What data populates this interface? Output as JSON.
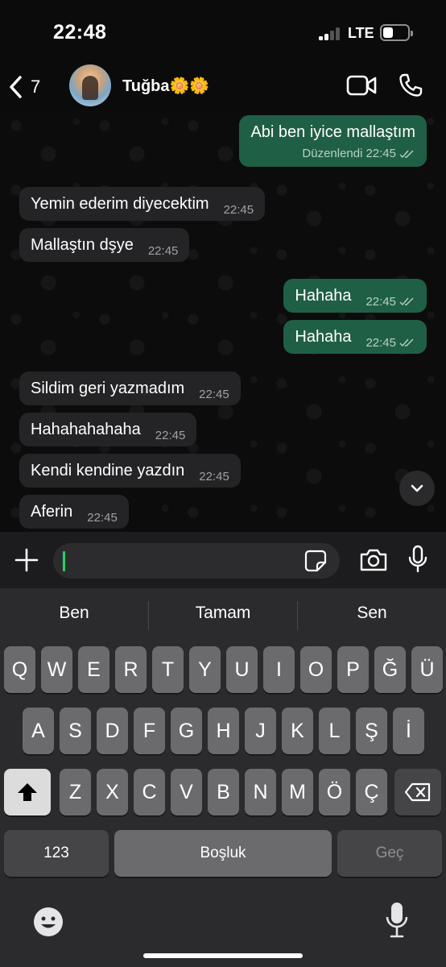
{
  "status": {
    "time": "22:48",
    "network": "LTE",
    "signal_bars": 2,
    "battery_level": 0.3
  },
  "header": {
    "back_count": "7",
    "contact_name": "Tuğba",
    "contact_emoji": "🌼🌼"
  },
  "messages": [
    {
      "dir": "out",
      "text": "Abi ben iyice mallaştım",
      "edited": "Düzenlendi",
      "time": "22:45"
    },
    {
      "dir": "in",
      "text": "Yemin ederim diyecektim",
      "time": "22:45"
    },
    {
      "dir": "in",
      "text": "Mallaştın dşye",
      "time": "22:45"
    },
    {
      "dir": "out",
      "text": "Hahaha",
      "time": "22:45"
    },
    {
      "dir": "out",
      "text": "Hahaha",
      "time": "22:45"
    },
    {
      "dir": "in",
      "text": "Sildim geri yazmadım",
      "time": "22:45"
    },
    {
      "dir": "in",
      "text": "Hahahahahaha",
      "time": "22:45"
    },
    {
      "dir": "in",
      "text": "Kendi kendine yazdın",
      "time": "22:45"
    },
    {
      "dir": "in",
      "text": "Aferin",
      "time": "22:45"
    }
  ],
  "composer": {
    "value": "",
    "placeholder": ""
  },
  "keyboard": {
    "suggestions": [
      "Ben",
      "Tamam",
      "Sen"
    ],
    "row1": [
      "Q",
      "W",
      "E",
      "R",
      "T",
      "Y",
      "U",
      "I",
      "O",
      "P",
      "Ğ",
      "Ü"
    ],
    "row2": [
      "A",
      "S",
      "D",
      "F",
      "G",
      "H",
      "J",
      "K",
      "L",
      "Ş",
      "İ"
    ],
    "row3": [
      "Z",
      "X",
      "C",
      "V",
      "B",
      "N",
      "M",
      "Ö",
      "Ç"
    ],
    "numbers_label": "123",
    "space_label": "Boşluk",
    "return_label": "Geç"
  },
  "colors": {
    "outgoing_bubble": "#1f5f45",
    "incoming_bubble": "#242426",
    "accent": "#25d366"
  },
  "icons": [
    "back-chevron-icon",
    "video-call-icon",
    "phone-icon",
    "plus-icon",
    "sticker-icon",
    "camera-icon",
    "microphone-icon",
    "chevron-down-icon",
    "shift-icon",
    "backspace-icon",
    "emoji-icon",
    "dictation-icon"
  ]
}
